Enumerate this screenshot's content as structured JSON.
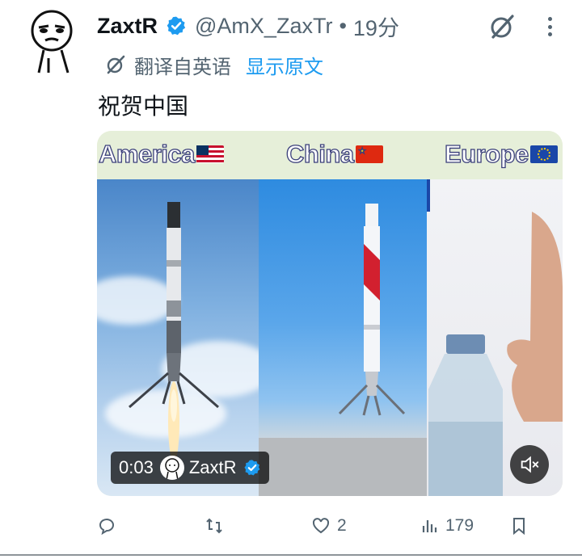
{
  "tweet": {
    "author_name": "ZaxtR",
    "handle": "@AmX_ZaxTr",
    "separator": "•",
    "time": "19分",
    "translation_note": "翻译自英语",
    "show_original": "显示原文",
    "text": "祝贺中国"
  },
  "media": {
    "labels": [
      "America",
      "China",
      "Europe"
    ],
    "flags": [
      "us-flag-icon",
      "cn-flag-icon",
      "eu-flag-icon"
    ],
    "video_time": "0:03",
    "video_author": "ZaxtR"
  },
  "actions": {
    "reply_count": "",
    "retweet_count": "",
    "like_count": "2",
    "view_count": "179"
  },
  "colors": {
    "verified_blue": "#1d9bf0",
    "text_primary": "#0f1419",
    "text_secondary": "#536471",
    "label_bar_bg": "#e6efd9"
  }
}
